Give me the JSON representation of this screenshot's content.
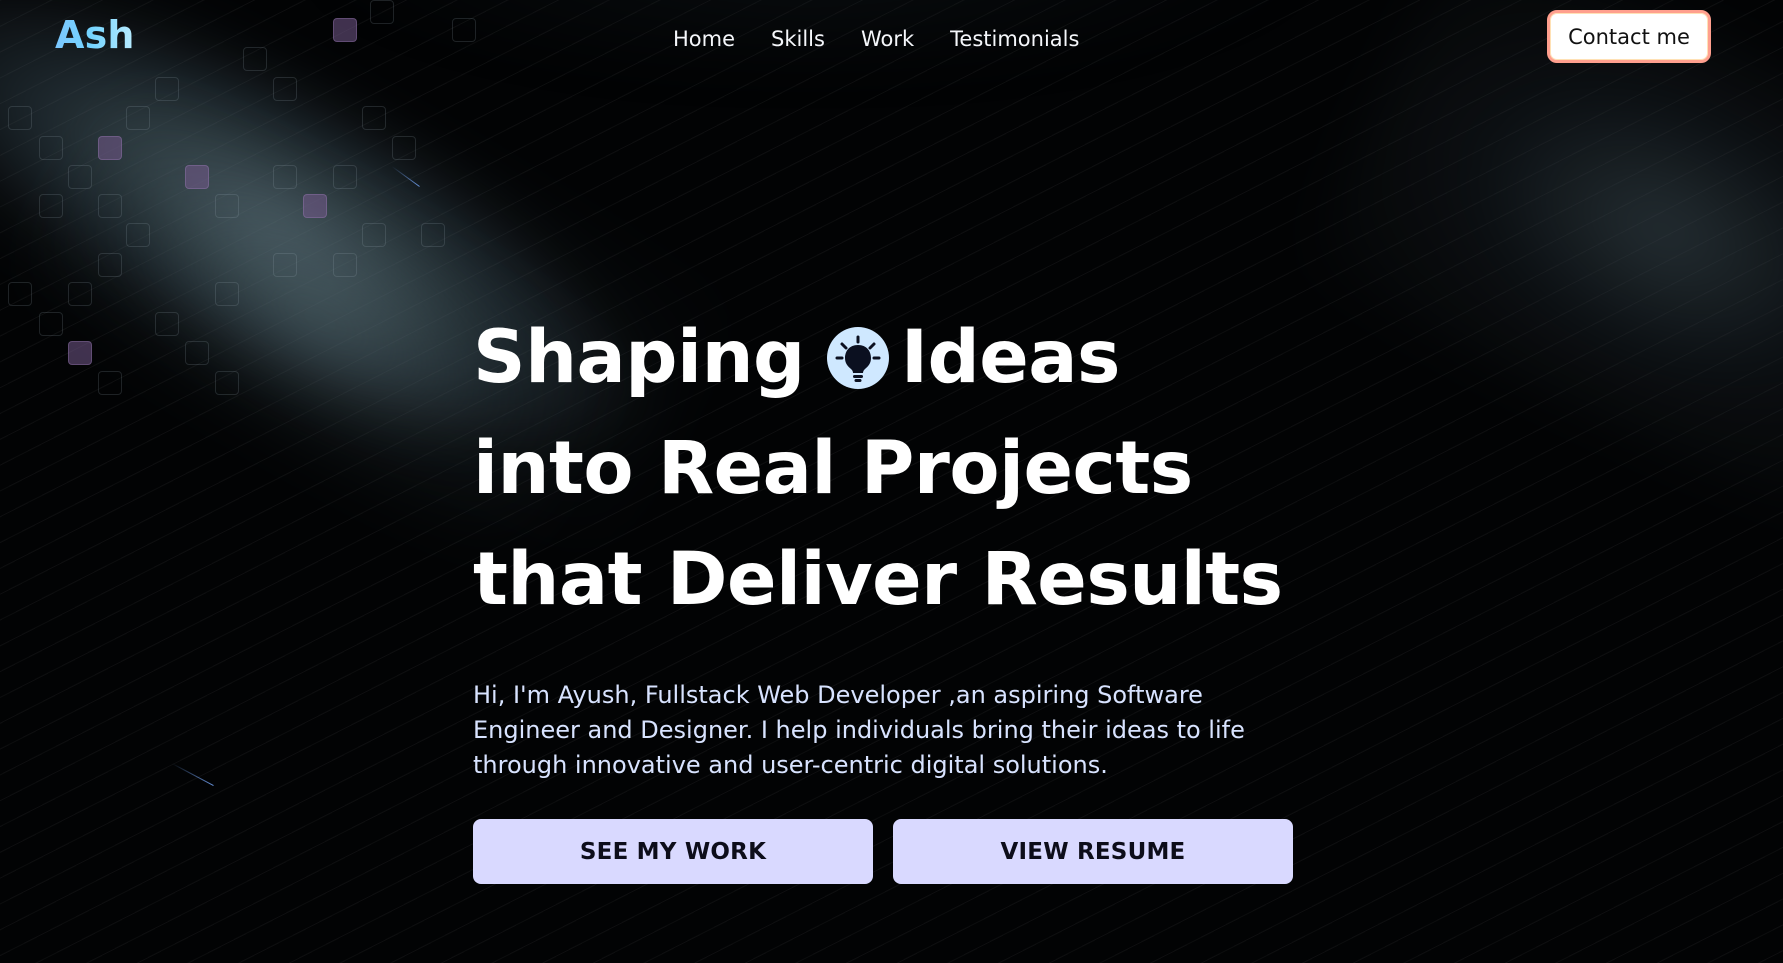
{
  "nav": {
    "logo": "Ash",
    "links": [
      "Home",
      "Skills",
      "Work",
      "Testimonials"
    ],
    "contact_label": "Contact me"
  },
  "hero": {
    "headline_line1_word1": "Shaping",
    "headline_line1_word2": "Ideas",
    "headline_line2": "into Real Projects",
    "headline_line3": "that Deliver Results",
    "description": "Hi, I'm Ayush, Fullstack Web Developer ,an aspiring Software Engineer and Designer. I help individuals bring their ideas to life through innovative and user-centric digital solutions.",
    "primary_button": "SEE MY WORK",
    "secondary_button": "VIEW RESUME"
  },
  "icons": {
    "headline_icon": "lightbulb-icon"
  },
  "colors": {
    "background": "#000000",
    "logo_gradient_start": "#7bc7ff",
    "logo_gradient_end": "#b9ecff",
    "cta_background": "#d9d9ff",
    "contact_border": "#ff9f8e"
  }
}
